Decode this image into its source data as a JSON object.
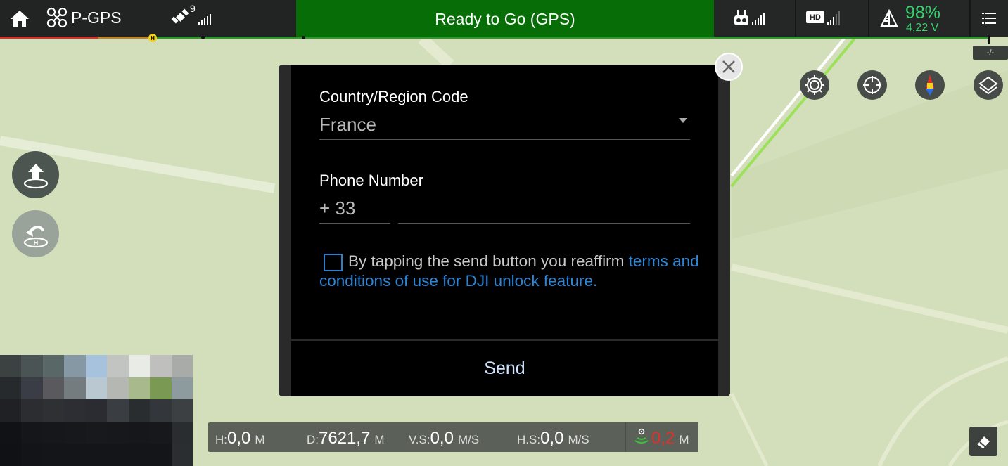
{
  "topbar": {
    "home_icon": "home-icon",
    "flight_mode": "P-GPS",
    "satellite_count": "9",
    "status": "Ready to Go (GPS)",
    "battery_percent": "98%",
    "battery_voltage": "4,22 V",
    "status_color": "#076d07",
    "battery_color": "#35d36e",
    "hd_label": "HD"
  },
  "map": {
    "ratio_label": "-/-",
    "tools": [
      "camera-settings-icon",
      "target-icon",
      "compass-icon",
      "layers-icon"
    ]
  },
  "left_controls": [
    "takeoff-icon",
    "return-home-icon"
  ],
  "dialog": {
    "country_label": "Country/Region Code",
    "country_value": "France",
    "phone_label": "Phone Number",
    "phone_prefix": "+ 33",
    "phone_value": "",
    "terms_text": "By tapping the send button you reaffirm ",
    "terms_link": "terms and conditions of use for DJI unlock feature.",
    "checkbox_checked": false,
    "send_label": "Send",
    "link_color": "#2c86d8"
  },
  "telemetry": {
    "h_key": "H:",
    "h_value": "0,0",
    "h_unit": "M",
    "d_key": "D:",
    "d_value": "7621,7",
    "d_unit": "M",
    "vs_key": "V.S:",
    "vs_value": "0,0",
    "vs_unit": "M/S",
    "hs_key": "H.S:",
    "hs_value": "0,0",
    "hs_unit": "M/S",
    "vps_value": "0,2",
    "vps_unit": "M",
    "vps_color": "#e0302a"
  }
}
